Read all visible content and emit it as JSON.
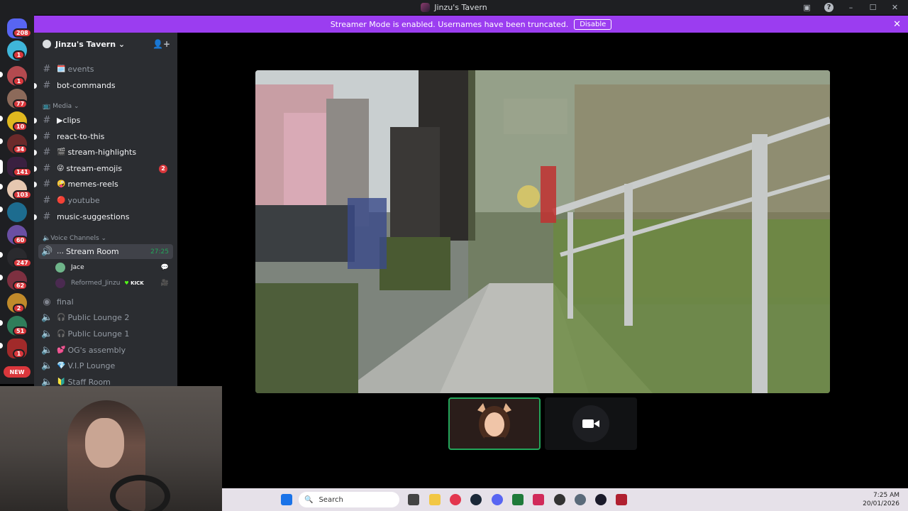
{
  "window": {
    "title": "Jinzu's Tavern",
    "minimize": "–",
    "maximize": "☐",
    "close": "✕"
  },
  "banner": {
    "text": "Streamer Mode is enabled. Usernames have been truncated.",
    "button": "Disable"
  },
  "guild_badges": [
    "208",
    "1",
    "1",
    "77",
    "10",
    "34",
    "141",
    "103",
    "60",
    "247",
    "62",
    "2",
    "51",
    "1"
  ],
  "guild_new": "NEW",
  "server": {
    "name": "Jinzu's Tavern ⌄"
  },
  "channels": [
    {
      "name": "events",
      "emoji": "🗓️",
      "muted": true
    },
    {
      "name": "bot-commands",
      "emoji": "",
      "muted": false
    },
    {
      "name": "▶clips",
      "emoji": "",
      "muted": false
    },
    {
      "name": "react-to-this",
      "emoji": "",
      "muted": false
    },
    {
      "name": "stream-highlights",
      "emoji": "🎬",
      "muted": false
    },
    {
      "name": "stream-emojis",
      "emoji": "😜",
      "muted": false,
      "badge": "2"
    },
    {
      "name": "memes-reels",
      "emoji": "🤪",
      "muted": false
    },
    {
      "name": "youtube",
      "emoji": "🔴",
      "muted": true
    },
    {
      "name": "music-suggestions",
      "emoji": "",
      "muted": false
    }
  ],
  "categories": {
    "media": "📺 Media ⌄",
    "voice": "🔈Voice Channels ⌄"
  },
  "voice": {
    "active": {
      "name": "Stream Room",
      "prefix": "…",
      "time": "27:25"
    },
    "users": [
      {
        "name": "Jace"
      },
      {
        "name": "Reformed_Jinzu",
        "tag": "KICK"
      }
    ],
    "others": [
      {
        "name": "final",
        "emoji": ""
      },
      {
        "name": "Public Lounge 2",
        "emoji": "🎧"
      },
      {
        "name": "Public Lounge 1",
        "emoji": "🎧"
      },
      {
        "name": "OG's assembly",
        "emoji": "💕"
      },
      {
        "name": "V.I.P Lounge",
        "emoji": "💎"
      },
      {
        "name": "Staff Room",
        "emoji": "🔰"
      }
    ]
  },
  "taskbar": {
    "search_placeholder": "Search",
    "time": "7:25 AM",
    "date": "20/01/2026"
  }
}
